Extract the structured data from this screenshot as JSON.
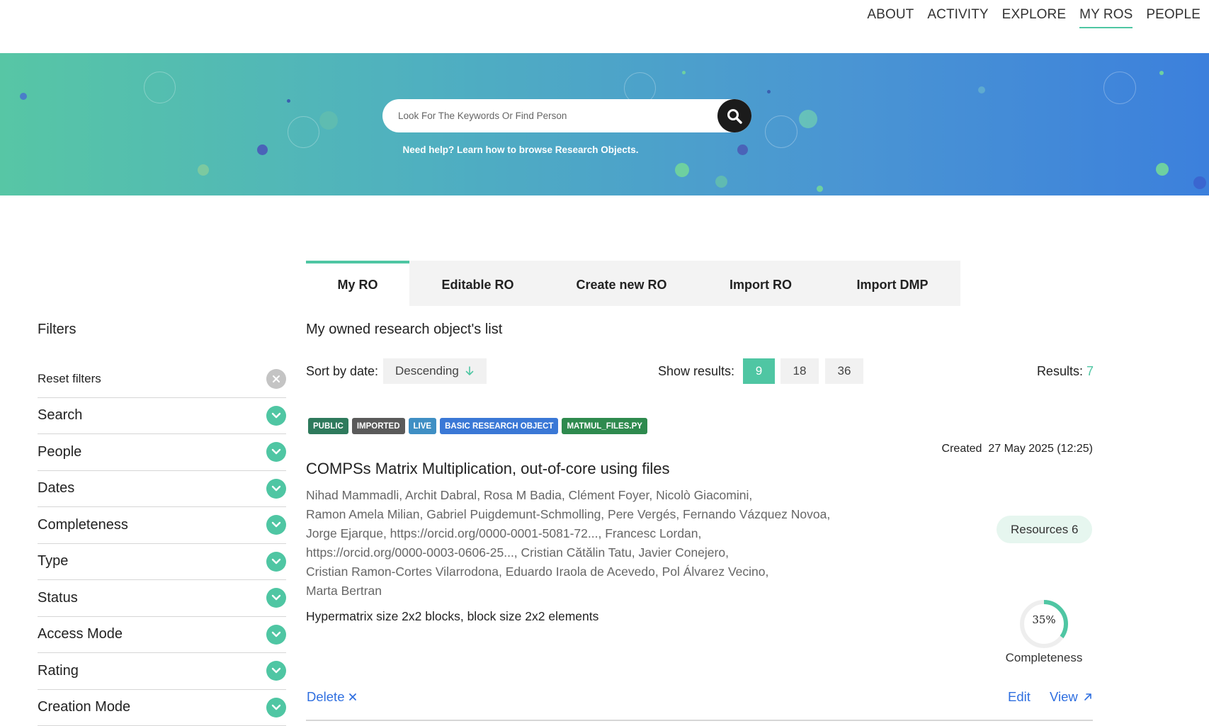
{
  "nav": {
    "items": [
      {
        "label": "ABOUT",
        "active": false
      },
      {
        "label": "ACTIVITY",
        "active": false
      },
      {
        "label": "EXPLORE",
        "active": false
      },
      {
        "label": "MY ROS",
        "active": true
      },
      {
        "label": "PEOPLE",
        "active": false
      }
    ]
  },
  "search": {
    "placeholder": "Look For The Keywords Or Find Person",
    "value": "",
    "icon": "search-icon",
    "help": "Need help? Learn how to browse Research Objects."
  },
  "tabs": [
    {
      "label": "My RO",
      "active": true
    },
    {
      "label": "Editable RO",
      "active": false
    },
    {
      "label": "Create new RO",
      "active": false
    },
    {
      "label": "Import RO",
      "active": false
    },
    {
      "label": "Import DMP",
      "active": false
    }
  ],
  "filters": {
    "title": "Filters",
    "reset_label": "Reset filters",
    "items": [
      "Search",
      "People",
      "Dates",
      "Completeness",
      "Type",
      "Status",
      "Access Mode",
      "Rating",
      "Creation Mode"
    ]
  },
  "list": {
    "title": "My owned research object's list",
    "sort_label": "Sort by date:",
    "sort_value": "Descending",
    "show_label": "Show results:",
    "page_sizes": [
      "9",
      "18",
      "36"
    ],
    "page_size_selected": "9",
    "results_label": "Results:",
    "results_count": "7"
  },
  "ro": {
    "badges": [
      {
        "label": "PUBLIC",
        "color": "#2e7a5c"
      },
      {
        "label": "IMPORTED",
        "color": "#5a5a5a"
      },
      {
        "label": "LIVE",
        "color": "#3f8fc4"
      },
      {
        "label": "BASIC RESEARCH OBJECT",
        "color": "#3a78d6"
      },
      {
        "label": "MATMUL_FILES.PY",
        "color": "#2e8a4e"
      }
    ],
    "created_label": "Created",
    "created_date": "27 May 2025 (12:25)",
    "title": "COMPSs Matrix Multiplication, out-of-core using files",
    "authors_lines": [
      "Nihad Mammadli,  Archit Dabral,  Rosa M Badia,  Clément Foyer,  Nicolò Giacomini,",
      "Ramon Amela Milian,  Gabriel Puigdemunt-Schmolling,  Pere Vergés,  Fernando Vázquez Novoa,",
      "Jorge Ejarque,  https://orcid.org/0000-0001-5081-72...,  Francesc Lordan,",
      "https://orcid.org/0000-0003-0606-25...,  Cristian Cătălin Tatu,  Javier Conejero,",
      "Cristian Ramon-Cortes Vilarrodona,  Eduardo Iraola de Acevedo,  Pol Álvarez Vecino,",
      "Marta Bertran"
    ],
    "description": "Hypermatrix size 2x2 blocks, block size 2x2 elements",
    "resources_label": "Resources 6",
    "completeness_value": 0.35,
    "completeness_text": "35%",
    "completeness_label": "Completeness",
    "delete_label": "Delete",
    "edit_label": "Edit",
    "view_label": "View"
  },
  "colors": {
    "accent": "#4fc6a3",
    "link": "#2f6fe0"
  }
}
